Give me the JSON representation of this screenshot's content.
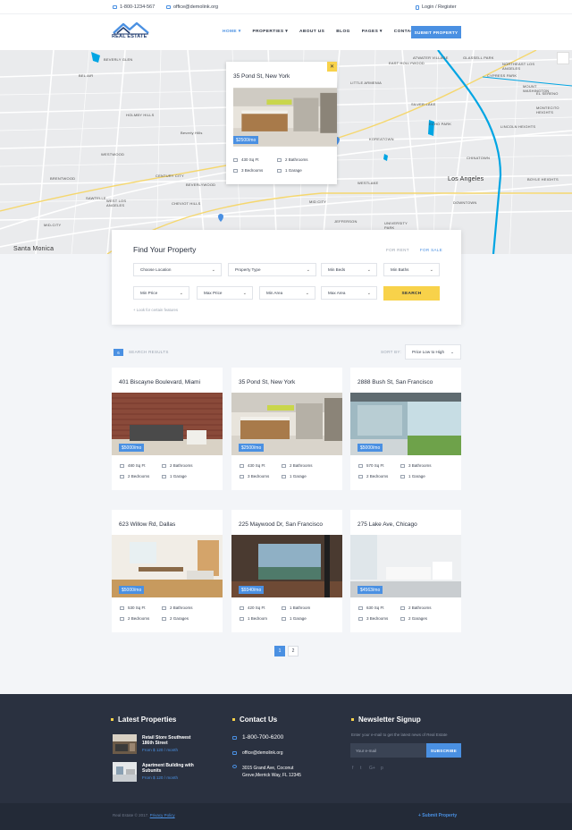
{
  "topbar": {
    "phone": "1-800-1234-567",
    "email": "office@demolink.org",
    "login": "Login / Register"
  },
  "header": {
    "logo_text": "REAL ESTATE",
    "nav": [
      {
        "label": "HOME",
        "active": true
      },
      {
        "label": "PROPERTIES",
        "active": false
      },
      {
        "label": "ABOUT US",
        "active": false
      },
      {
        "label": "BLOG",
        "active": false
      },
      {
        "label": "PAGES",
        "active": false
      },
      {
        "label": "CONTACT",
        "active": false
      }
    ],
    "submit_label": "SUBMIT PROPERTY"
  },
  "map": {
    "labels": [
      "BEVERLY GLEN",
      "BEL AIR",
      "HOLMBY HILLS",
      "Beverly Hills",
      "WESTWOOD",
      "BRENTWOOD",
      "CENTURY CITY",
      "BEVERLYWOOD",
      "SAWTELLE",
      "WEST LOS ANGELES",
      "CHEVIOT HILLS",
      "MID-CITY",
      "Santa Monica",
      "LITTLE ARMENIA",
      "EAST HOLLYWOOD",
      "SILVER LAKE",
      "ECHO PARK",
      "KOREATOWN",
      "CHINATOWN",
      "Los Angeles",
      "DOWNTOWN",
      "WESTLAKE",
      "MID CITY",
      "JEFFERSON",
      "UNIVERSITY PARK",
      "EL SERENO",
      "NORTHEAST LOS ANGELES",
      "CYPRESS PARK",
      "MONTECITO HEIGHTS",
      "BOYLE HEIGHTS",
      "LINCOLN HEIGHTS",
      "GLASSELL PARK",
      "ATWATER VILLAGE",
      "MOUNT WASHINGTON"
    ],
    "popup": {
      "title": "35 Pond St, New York",
      "price": "$2500/mo",
      "area": "430 Sq Ft",
      "baths": "2 Bathrooms",
      "beds": "3 Bedrooms",
      "garage": "1 Garage"
    }
  },
  "finder": {
    "title": "Find Your Property",
    "tab_rent": "FOR RENT",
    "tab_sale": "FOR SALE",
    "location": "Choose Location",
    "type": "Property Type",
    "min_beds": "Min Beds",
    "min_baths": "Min Baths",
    "min_price": "Min Price",
    "max_price": "Max Price",
    "min_area": "Min Area",
    "max_area": "Max Area",
    "search": "SEARCH",
    "look": "+   Look for certain features"
  },
  "results": {
    "count": "6",
    "label": "SEARCH RESULTS",
    "sort_label": "SORT BY:",
    "sort_value": "Price Low to High"
  },
  "listings": [
    {
      "title": "401 Biscayne Boulevard, Miami",
      "price": "$5000/mo",
      "area": "480 Sq Ft",
      "baths": "2 Bathrooms",
      "beds": "2 Bedrooms",
      "garage": "1 Garage",
      "img": "brick"
    },
    {
      "title": "35 Pond St, New York",
      "price": "$2500/mo",
      "area": "430 Sq Ft",
      "baths": "2 Bathrooms",
      "beds": "3 Bedrooms",
      "garage": "1 Garage",
      "img": "kitchen"
    },
    {
      "title": "2888 Bush St, San Francisco",
      "price": "$5000/mo",
      "area": "570 Sq Ft",
      "baths": "3 Bathrooms",
      "beds": "2 Bedrooms",
      "garage": "1 Garage",
      "img": "glass"
    },
    {
      "title": "623 Willow Rd, Dallas",
      "price": "$5000/mo",
      "area": "530 Sq Ft",
      "baths": "2 Bathrooms",
      "beds": "2 Bedrooms",
      "garage": "2 Garages",
      "img": "dining"
    },
    {
      "title": "225 Maywood Dr, San Francisco",
      "price": "$9340/mo",
      "area": "420 Sq Ft",
      "baths": "1 Bathroom",
      "beds": "1 Bedroom",
      "garage": "1 Garage",
      "img": "view"
    },
    {
      "title": "275 Lake Ave, Chicago",
      "price": "$4563/mo",
      "area": "630 Sq Ft",
      "baths": "2 Bathrooms",
      "beds": "3 Bedrooms",
      "garage": "2 Garages",
      "img": "white"
    }
  ],
  "pagination": [
    "1",
    "2"
  ],
  "footer": {
    "latest_title": "Latest Properties",
    "latest": [
      {
        "name": "Retail Store Southwest 186th Street",
        "price": "From $ 120 / month"
      },
      {
        "name": "Apartment Building with Subunits",
        "price": "From $ 120 / month"
      }
    ],
    "contact_title": "Contact Us",
    "phone": "1-800-700-6200",
    "email": "office@demolink.org",
    "address": "3015 Grand Ave, Coconut Grove,Merrick Way, FL 12345",
    "newsletter_title": "Newsletter Signup",
    "newsletter_text": "Enter your e-mail to get the latest news of Real Estate",
    "email_placeholder": "Your e-mail",
    "subscribe": "SUBSCRIBE",
    "social": [
      "f",
      "t",
      "G+",
      "p"
    ],
    "copyright": "Real Estate © 2017.",
    "privacy": "Privacy Policy",
    "submit": "+ Submit Property"
  },
  "colors": {
    "accent": "#4a90e2",
    "yellow": "#f8d24a",
    "footer": "#2a3140"
  }
}
